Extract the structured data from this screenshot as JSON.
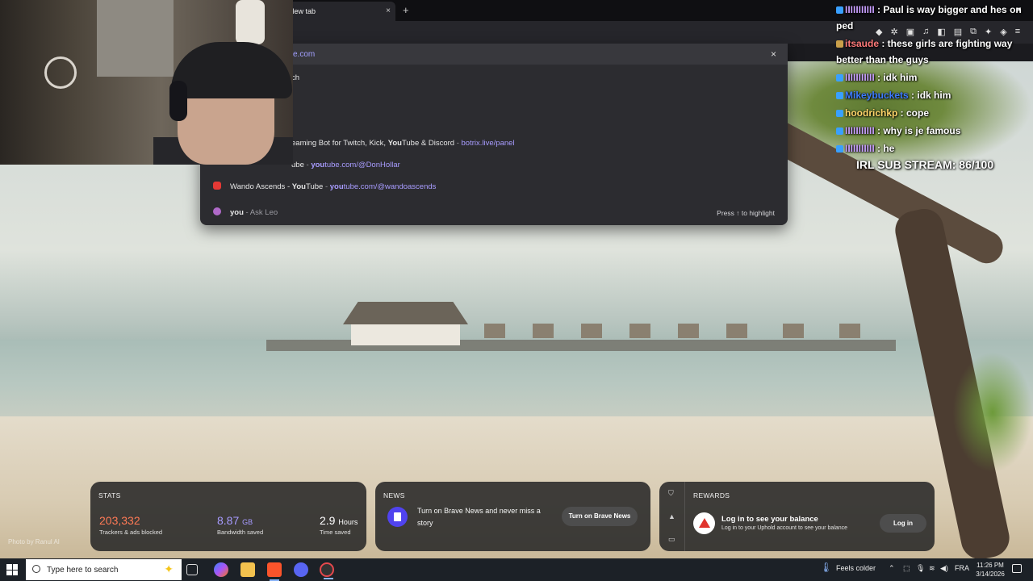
{
  "browser": {
    "tab_title": "New tab",
    "tab_close": "×",
    "new_tab": "+",
    "address_fragment": "e.com",
    "address_close": "×"
  },
  "omnibox": {
    "rows": [
      {
        "text": "ch",
        "url": "",
        "icon_color": "#2c2c30"
      },
      {
        "text": "eaming Bot for Twitch, Kick, ",
        "bold": "You",
        "rest": "Tube & Discord",
        "sep": " - ",
        "url": "botrix.live/panel",
        "icon_color": "#2c2c30"
      },
      {
        "text": "ube",
        "sep": " - ",
        "url_bold": "you",
        "url": "tube.com/@DonHollar",
        "icon_color": "#2c2c30"
      },
      {
        "text": "Wando Ascends - ",
        "bold": "You",
        "rest": "Tube",
        "sep": " - ",
        "url_bold": "you",
        "url": "tube.com/@wandoascends",
        "icon_color": "#e53935"
      },
      {
        "bold": "you",
        "dim": " - Ask Leo",
        "hint": "Press ↑ to highlight",
        "icon_color": "#b06ac9"
      }
    ]
  },
  "chat": {
    "messages": [
      {
        "user": "IIIIIIIIIII",
        "text": " : Paul is way bigger and hes on ped",
        "user_color": "#c9a0ff"
      },
      {
        "user": "itsaude",
        "text": " : these girls are fighting way better than the guys",
        "user_color": "#ff7a7a"
      },
      {
        "user": "IIIIIIIIIII",
        "text": " : idk him",
        "user_color": "#c9a0ff"
      },
      {
        "user": "Mikeybuckets",
        "text": " : idk him",
        "user_color": "#3d7bff"
      },
      {
        "user": "hoodrichkp",
        "text": " : cope",
        "user_color": "#ffd56a"
      },
      {
        "user": "IIIIIIIIIII",
        "text": " : why is je famous",
        "user_color": "#c9a0ff"
      },
      {
        "user": "IIIIIIIIIII",
        "text": " : he",
        "user_color": "#c9a0ff"
      }
    ],
    "sub_goal": "IRL SUB STREAM: 86/100",
    "close": "×"
  },
  "stats": {
    "header": "STATS",
    "trackers_value": "203,332",
    "trackers_label": "Trackers & ads blocked",
    "trackers_color": "#ff7a55",
    "bandwidth_value": "8.87",
    "bandwidth_unit": "GB",
    "bandwidth_label": "Bandwidth saved",
    "bandwidth_color": "#a79bff",
    "time_value": "2.9",
    "time_unit": "Hours",
    "time_label": "Time saved"
  },
  "news": {
    "header": "NEWS",
    "message": "Turn on Brave News and never miss a story",
    "button": "Turn on Brave News"
  },
  "rewards": {
    "header": "REWARDS",
    "title": "Log in to see your balance",
    "subtitle": "Log in to your Uphold account to see your balance",
    "button": "Log in"
  },
  "photo_credit": "Photo by Ranul Al",
  "taskbar": {
    "search_placeholder": "Type here to search",
    "weather": "Feels colder",
    "language": "FRA",
    "time": "11:26 PM",
    "date": "3/14/2026"
  }
}
